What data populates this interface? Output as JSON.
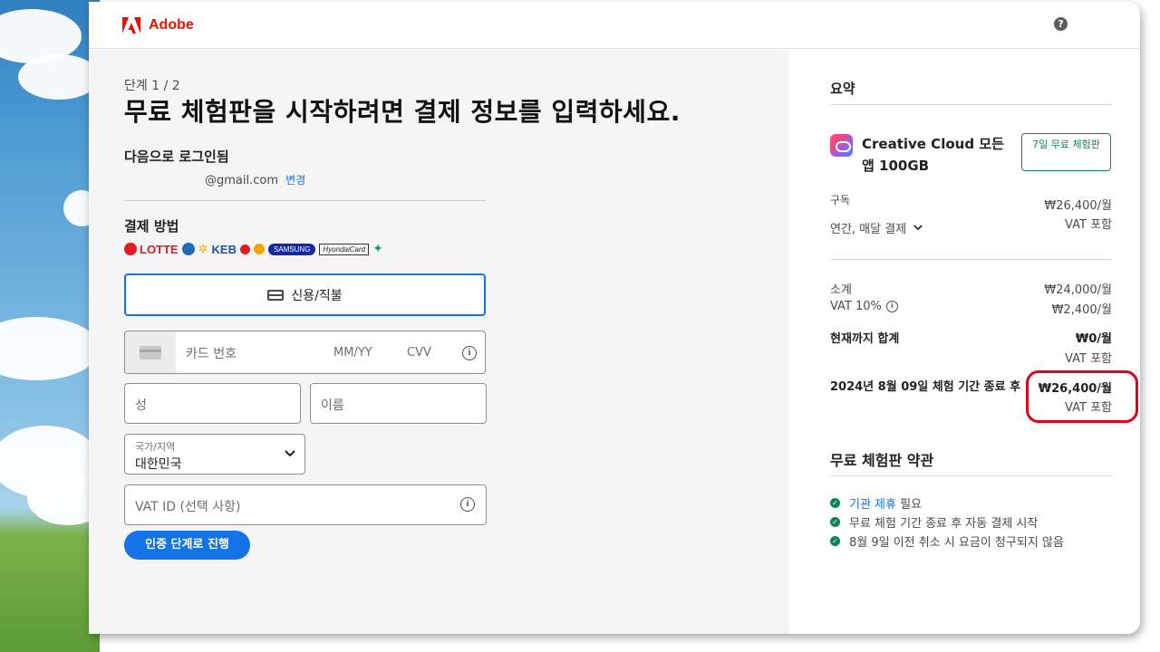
{
  "header": {
    "brand": "Adobe",
    "help_symbol": "?"
  },
  "checkout": {
    "step": "단계 1 / 2",
    "headline": "무료 체험판을 시작하려면 결제 정보를 입력하세요.",
    "login_label": "다음으로 로그인됨",
    "email": "@gmail.com",
    "change_link": "변경",
    "payment_label": "결제 방법",
    "brands": {
      "lotte": "LOTTE",
      "keb": "KEB",
      "samsung": "SAMSUNG",
      "hyundai": "HyundaiCard"
    },
    "card_type_button": "신용/직불",
    "card_number_placeholder": "카드 번호",
    "expiry_placeholder": "MM/YY",
    "cvv_placeholder": "CVV",
    "info_symbol": "i",
    "last_name_placeholder": "성",
    "first_name_placeholder": "이름",
    "country_label": "국가/지역",
    "country_value": "대한민국",
    "vat_placeholder": "VAT ID (선택 사항)",
    "submit_label": "인증 단계로 진행"
  },
  "summary": {
    "title": "요약",
    "product_name": "Creative Cloud 모든 앱 100GB",
    "trial_badge": "7일 무료 체험판",
    "subscription_label": "구독",
    "subscription_plan": "연간, 매달 결제",
    "subscription_price": "₩26,400/월",
    "vat_included": "VAT 포함",
    "subtotal_label": "소계",
    "subtotal_value": "₩24,000/월",
    "vat_label": "VAT 10%",
    "vat_value": "₩2,400/월",
    "total_today_label": "현재까지 합계",
    "total_today_value": "₩0/월",
    "after_trial_label": "2024년 8월 09일 체험 기간 종료 후",
    "after_trial_value": "₩26,400/월",
    "terms_title": "무료 체험판 약관",
    "terms": {
      "item1_link": "기관 제휴",
      "item1_rest": "필요",
      "item2": "무료 체험 기간 종료 후 자동 결제 시작",
      "item3": "8월 9일 이전 취소 시 요금이 청구되지 않음"
    }
  },
  "icons": {
    "help": "help-icon",
    "credit_card": "credit-card-icon",
    "info": "info-icon",
    "chevron": "chevron-down-icon",
    "check": "check-circle-icon",
    "creative_cloud": "creative-cloud-icon"
  },
  "colors": {
    "adobe_red": "#eb1000",
    "accent_blue": "#1473e6",
    "success_green": "#12805c",
    "highlight_red": "#e0001b"
  }
}
